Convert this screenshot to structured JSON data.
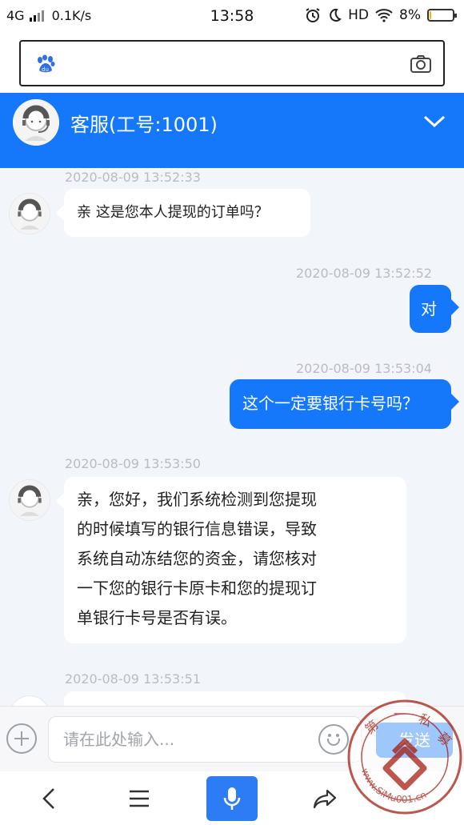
{
  "status_bar": {
    "network": "4G",
    "speed": "0.1K/s",
    "time": "13:58",
    "hd": "HD",
    "battery": "8%",
    "battery_level": 0.08
  },
  "icons": {
    "baidu": "baidu-paw-icon",
    "camera": "camera-icon",
    "collapse": "chevron-down-icon",
    "plus": "plus-icon",
    "emoji": "emoji-icon",
    "back": "back-arrow-icon",
    "menu": "menu-icon",
    "mic": "microphone-icon",
    "share": "share-icon"
  },
  "header": {
    "title": "客服(工号:1001)"
  },
  "messages": [
    {
      "time": "2020-08-09 13:52:33",
      "side": "in",
      "lines": [
        "亲 这是您本人提现的订单吗？"
      ]
    },
    {
      "time": "2020-08-09 13:52:52",
      "side": "out",
      "lines": [
        "对"
      ]
    },
    {
      "time": "2020-08-09 13:53:04",
      "side": "out",
      "lines": [
        "这个一定要银行卡号吗？"
      ]
    },
    {
      "time": "2020-08-09 13:53:50",
      "side": "in",
      "lines": [
        "亲，您好，我们系统检测到您提现",
        "的时候填写的银行信息错误，导致",
        "系统自动冻结您的资金，请您核对",
        "一下您的银行卡原卡和您的提现订",
        "单银行卡号是否有误。"
      ]
    },
    {
      "time": "2020-08-09 13:53:51",
      "side": "in",
      "lines": []
    }
  ],
  "input": {
    "placeholder": "请在此处输入...",
    "send_label": "发送"
  },
  "watermark": {
    "chars": [
      "第",
      "一",
      "私",
      "募"
    ],
    "url": "www.SiMu001.cn"
  },
  "colors": {
    "brand": "#1578fa",
    "background": "#f2f5fa"
  }
}
